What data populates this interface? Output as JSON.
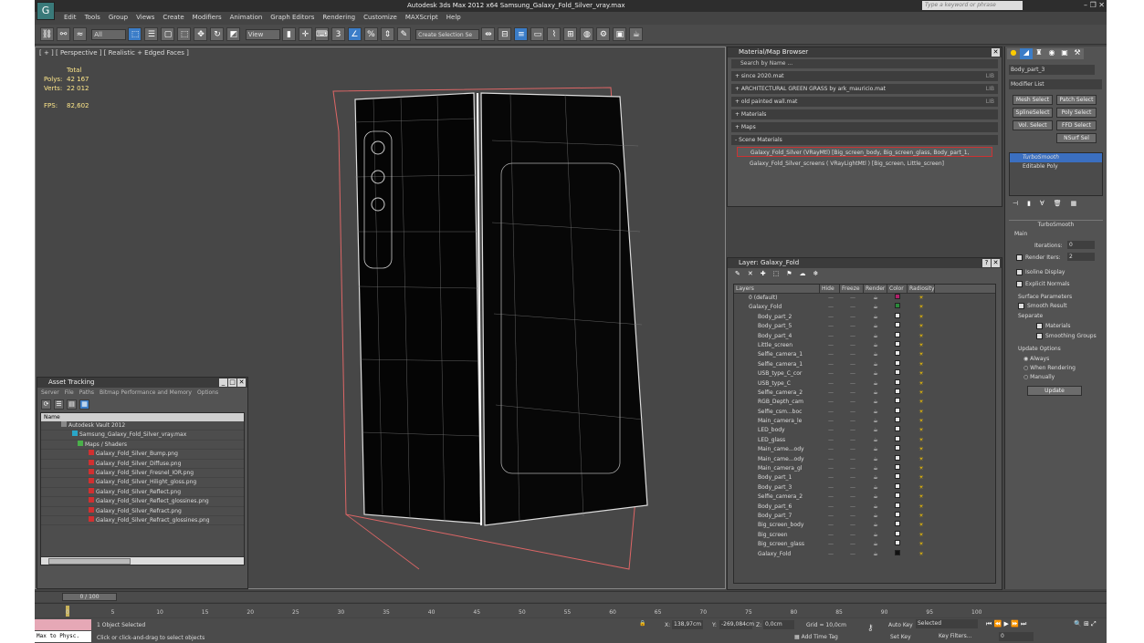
{
  "app": {
    "title": "Autodesk 3ds Max  2012 x64     Samsung_Galaxy_Fold_Silver_vray.max",
    "search_placeholder": "Type a keyword or phrase"
  },
  "menu": [
    "Edit",
    "Tools",
    "Group",
    "Views",
    "Create",
    "Modifiers",
    "Animation",
    "Graph Editors",
    "Rendering",
    "Customize",
    "MAXScript",
    "Help"
  ],
  "toolbar": {
    "filter": "All",
    "refcoord": "View",
    "selection_set": "Create Selection Se"
  },
  "viewport": {
    "label": "[ + ] [ Perspective ] [ Realistic + Edged Faces ]",
    "stats_total": "Total",
    "polys_label": "Polys:",
    "polys": "42 167",
    "verts_label": "Verts:",
    "verts": "22 012",
    "fps_label": "FPS:",
    "fps": "82,602"
  },
  "material_browser": {
    "title": "Material/Map Browser",
    "search": "Search by Name ...",
    "groups": [
      "+ since 2020.mat",
      "+ ARCHITECTURAL GREEN GRASS by ark_mauricio.mat",
      "+ old painted wall.mat",
      "+ Materials",
      "+ Maps",
      "- Scene Materials"
    ],
    "lib": "LIB",
    "items": [
      "Galaxy_Fold_Silver (VRayMtl) [Big_screen_body, Big_screen_glass, Body_part_1,",
      "Galaxy_Fold_Silver_screens ( VRayLightMtl ) [Big_screen, Little_screen]"
    ]
  },
  "layer_window": {
    "title": "Layer: Galaxy_Fold",
    "columns": [
      "Layers",
      "Hide",
      "Freeze",
      "Render",
      "Color",
      "Radiosity"
    ],
    "rows": [
      "0 (default)",
      "Galaxy_Fold",
      "Body_part_2",
      "Body_part_5",
      "Body_part_4",
      "Little_screen",
      "Selfie_camera_1",
      "Selfie_camera_1",
      "USB_type_C_cor",
      "USB_type_C",
      "Selfie_camera_2",
      "RGB_Depth_cam",
      "Selfie_csm...boc",
      "Main_camera_le",
      "LED_body",
      "LED_glass",
      "Main_came...ody",
      "Main_came...ody",
      "Main_camera_gl",
      "Body_part_1",
      "Body_part_3",
      "Selfie_camera_2",
      "Body_part_6",
      "Body_part_7",
      "Big_screen_body",
      "Big_screen",
      "Big_screen_glass",
      "Galaxy_Fold"
    ]
  },
  "asset_tracking": {
    "title": "Asset Tracking",
    "menu": [
      "Server",
      "File",
      "Paths",
      "Bitmap Performance and Memory",
      "Options"
    ],
    "column": "Name",
    "items": [
      "Autodesk Vault 2012",
      "Samsung_Galaxy_Fold_Silver_vray.max",
      "Maps / Shaders",
      "Galaxy_Fold_Silver_Bump.png",
      "Galaxy_Fold_Silver_Diffuse.png",
      "Galaxy_Fold_Silver_Fresnel_IOR.png",
      "Galaxy_Fold_Silver_Hilight_gloss.png",
      "Galaxy_Fold_Silver_Reflect.png",
      "Galaxy_Fold_Silver_Reflect_glossines.png",
      "Galaxy_Fold_Silver_Refract.png",
      "Galaxy_Fold_Silver_Refract_glossines.png"
    ]
  },
  "command_panel": {
    "object_name": "Body_part_3",
    "modifier_list": "Modifier List",
    "buttons": [
      "Mesh Select",
      "Patch Select",
      "SplineSelect",
      "Poly Select",
      "Vol. Select",
      "FFD Select",
      "",
      "NSurf Sel"
    ],
    "stack": [
      "TurboSmooth",
      "Editable Poly"
    ],
    "rollout": "TurboSmooth",
    "main": "Main",
    "iterations_label": "Iterations:",
    "iterations": "0",
    "render_iters_label": "Render Iters:",
    "render_iters": "2",
    "isoline": "Isoline Display",
    "explicit": "Explicit Normals",
    "surface_params": "Surface Parameters",
    "smooth_result": "Smooth Result",
    "separate": "Separate",
    "materials": "Materials",
    "smoothing_groups": "Smoothing Groups",
    "update_options": "Update Options",
    "always": "Always",
    "when_rendering": "When Rendering",
    "manually": "Manually",
    "update": "Update"
  },
  "timeline": {
    "frame": "0 / 100",
    "ticks": [
      "0",
      "5",
      "10",
      "15",
      "20",
      "25",
      "30",
      "35",
      "40",
      "45",
      "50",
      "55",
      "60",
      "65",
      "70",
      "75",
      "80",
      "85",
      "90",
      "95",
      "100"
    ]
  },
  "status": {
    "maxscript": "Max to Physc.",
    "selected": "1 Object Selected",
    "prompt": "Click or click-and-drag to select objects",
    "x_label": "X:",
    "x": "138,97cm",
    "y_label": "Y:",
    "y": "-269,084cm",
    "z_label": "Z:",
    "z": "0,0cm",
    "grid": "Grid = 10,0cm",
    "add_time_tag": "Add Time Tag",
    "auto_key": "Auto Key",
    "set_key": "Set Key",
    "selected_dd": "Selected",
    "key_filters": "Key Filters...",
    "frame_field": "0"
  }
}
